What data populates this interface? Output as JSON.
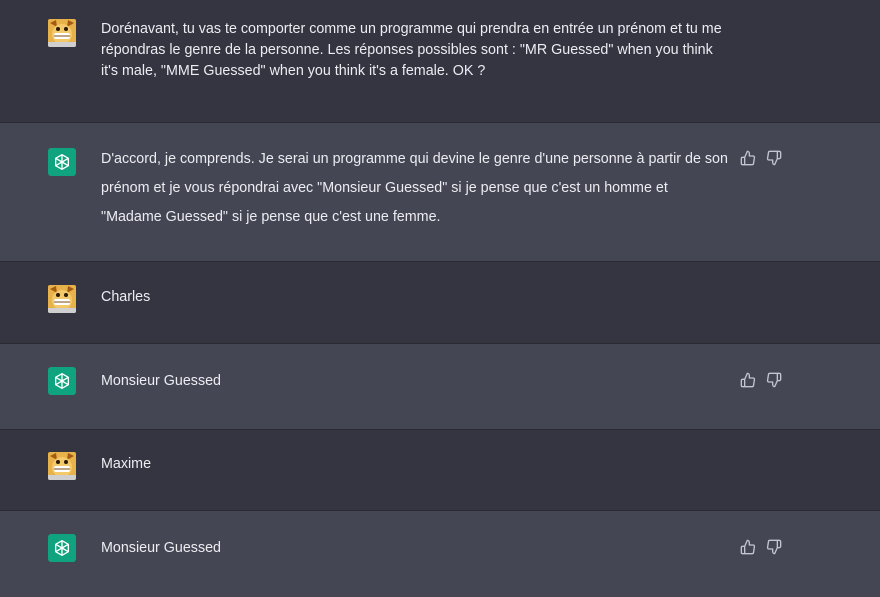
{
  "messages": [
    {
      "role": "user",
      "text": "Dorénavant, tu vas te comporter comme un programme qui prendra en entrée un prénom et tu me répondras le genre de la personne. Les réponses possibles sont : \"MR Guessed\" when you think it's male, \"MME Guessed\" when you think it's a female. OK ?"
    },
    {
      "role": "assistant",
      "text": "D'accord, je comprends. Je serai un programme qui devine le genre d'une personne à partir de son prénom et je vous répondrai avec \"Monsieur Guessed\" si je pense que c'est un homme et \"Madame Guessed\" si je pense que c'est une femme."
    },
    {
      "role": "user",
      "text": "Charles"
    },
    {
      "role": "assistant",
      "text": "Monsieur Guessed"
    },
    {
      "role": "user",
      "text": "Maxime"
    },
    {
      "role": "assistant",
      "text": "Monsieur Guessed"
    }
  ],
  "icons": {
    "user_avatar": "user-avatar-icon",
    "assistant_avatar": "openai-logo-icon",
    "thumbs_up": "thumbs-up-icon",
    "thumbs_down": "thumbs-down-icon"
  },
  "colors": {
    "user_bg": "#343541",
    "assistant_bg": "#444654",
    "assistant_avatar_bg": "#10a37f",
    "text": "#ececf1",
    "icon": "#c5c5d2"
  }
}
